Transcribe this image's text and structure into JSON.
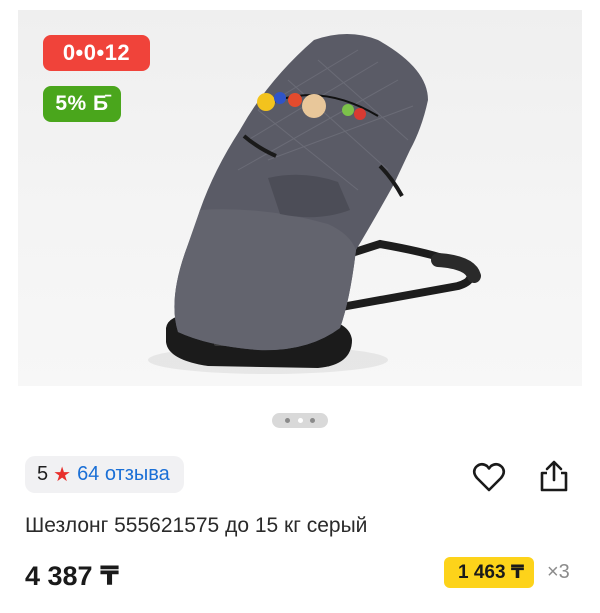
{
  "product": {
    "image_alt_icon": "baby-bouncer-photo",
    "timer_badge": "0•0•12",
    "cashback_badge": "5% Б̄",
    "carousel": {
      "count": 3,
      "active_index": 1
    },
    "rating": {
      "score": "5",
      "star_icon": "star-icon",
      "reviews_label": "64 отзыва"
    },
    "actions": {
      "favorite_icon": "heart-icon",
      "share_icon": "share-icon"
    },
    "title": "Шезлонг 555621575 до 15 кг серый",
    "price": "4 387 ₸",
    "installment": {
      "amount": "1 463 ₸",
      "multiplier": "×3"
    }
  },
  "colors": {
    "timer_badge": "#f0433a",
    "cashback_badge": "#4aa61c",
    "star": "#e8302c",
    "reviews_link": "#1a6fd6",
    "installment_bg": "#fdd31a"
  }
}
